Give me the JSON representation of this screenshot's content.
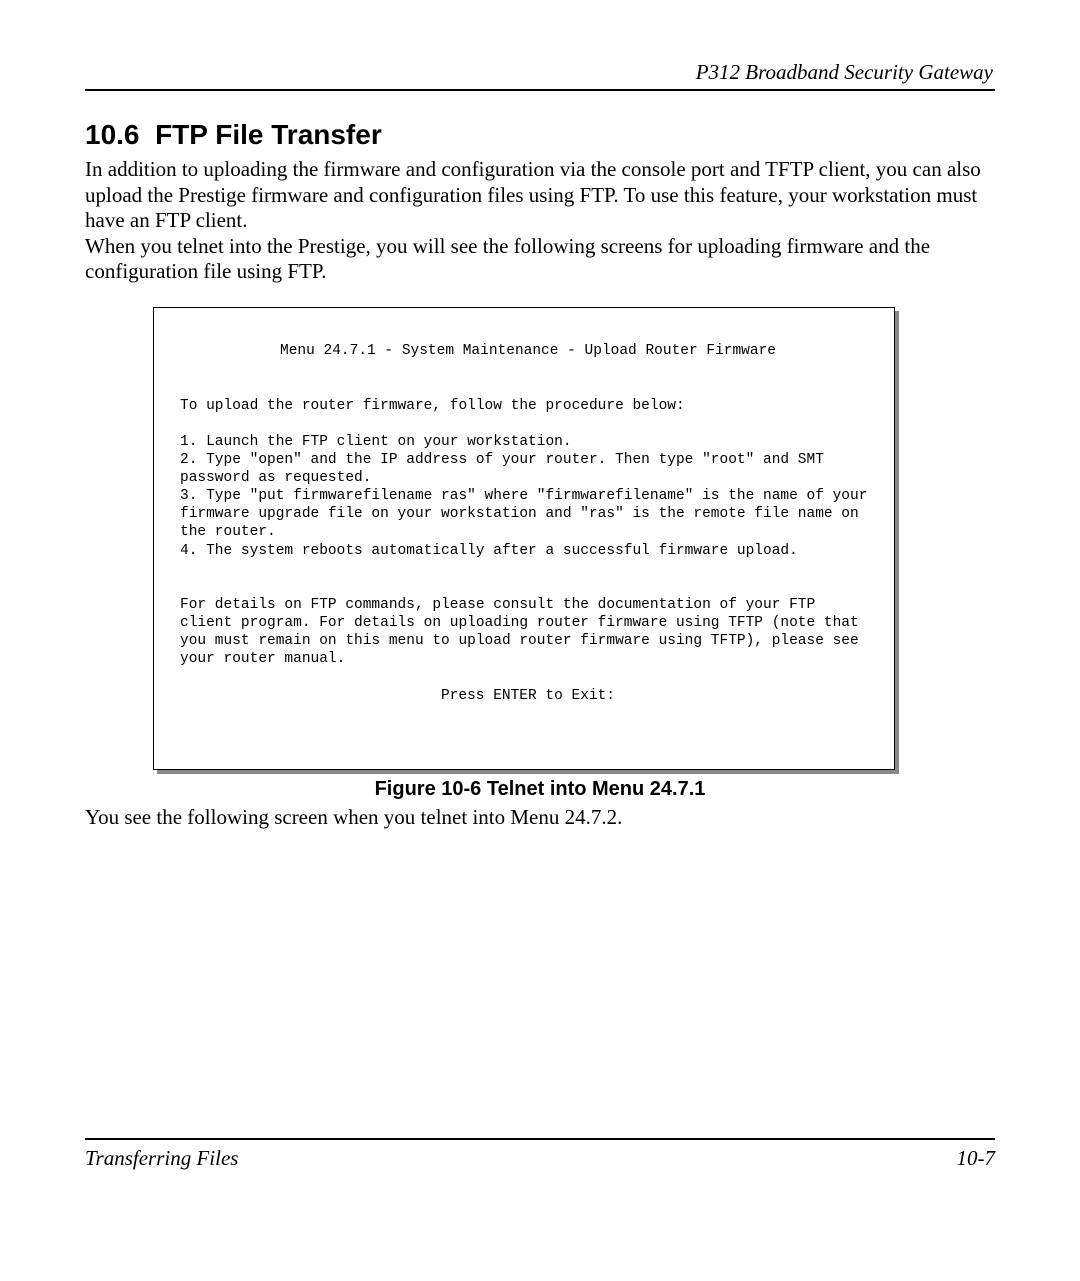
{
  "header": {
    "product": "P312  Broadband Security Gateway"
  },
  "section": {
    "number": "10.6",
    "title": "FTP File Transfer"
  },
  "para1": "In addition to uploading the firmware and configuration via the console port and TFTP client, you can also upload the Prestige firmware and configuration files using FTP. To use this feature, your workstation must have an FTP client.",
  "para2": "When you telnet into the Prestige, you will see the following screens for uploading firmware and the configuration file using FTP.",
  "terminal": {
    "menu_title": "Menu 24.7.1 - System Maintenance - Upload Router Firmware",
    "intro": "To upload the router firmware, follow the procedure below:",
    "step1": "1. Launch the FTP client on your workstation.",
    "step2": "2. Type \"open\" and the IP address of your router. Then type \"root\" and SMT password as requested.",
    "step3": "3. Type \"put firmwarefilename ras\" where \"firmwarefilename\" is the name of your firmware upgrade file on your workstation and \"ras\" is the remote file name on the router.",
    "step4": "4. The system reboots automatically after a successful firmware upload.",
    "details": "For details on FTP commands, please consult the documentation of your FTP client program. For details on uploading router firmware using TFTP (note that you must remain on this menu to upload router firmware using TFTP), please see your router manual.",
    "exit": "Press ENTER to Exit:"
  },
  "figure_caption": "Figure 10-6      Telnet into Menu 24.7.1",
  "para3": "You see the following screen when you telnet into Menu 24.7.2.",
  "footer": {
    "left": "Transferring Files",
    "right": "10-7"
  }
}
